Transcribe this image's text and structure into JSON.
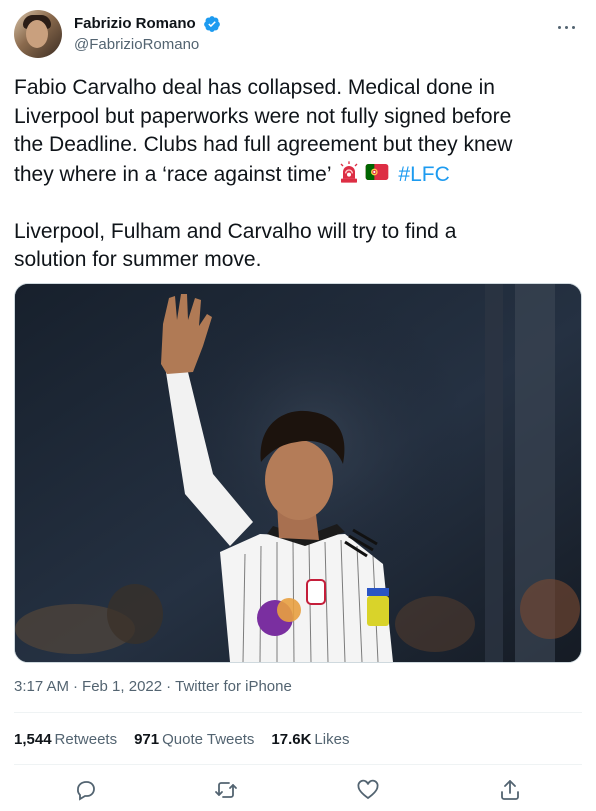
{
  "author": {
    "display_name": "Fabrizio Romano",
    "handle": "@FabrizioRomano",
    "verified": true,
    "avatar_icon": "avatar-photo"
  },
  "tweet": {
    "line1": "Fabio Carvalho deal has collapsed. Medical done in",
    "line2": "Liverpool but paperworks were not fully signed before",
    "line3": "the Deadline. Clubs had full agreement but they knew",
    "line4": "they where in a ‘race against time’",
    "hashtag": "#LFC",
    "line5": "Liverpool, Fulham and Carvalho will try to find a",
    "line6": "solution for summer move.",
    "emojis": [
      "rotating-light-icon",
      "portugal-flag-icon"
    ]
  },
  "media": {
    "description_icon": "photo-player-waving"
  },
  "meta": {
    "time": "3:17 AM",
    "separator": "·",
    "date": "Feb 1, 2022",
    "source": "Twitter for iPhone"
  },
  "stats": {
    "retweets_count": "1,544",
    "retweets_label": "Retweets",
    "quotes_count": "971",
    "quotes_label": "Quote Tweets",
    "likes_count": "17.6K",
    "likes_label": "Likes"
  },
  "colors": {
    "text": "#0f1419",
    "secondary": "#536471",
    "link": "#1d9bf0",
    "border": "#eff3f4"
  },
  "actions": [
    "reply-icon",
    "retweet-icon",
    "like-icon",
    "share-icon"
  ]
}
